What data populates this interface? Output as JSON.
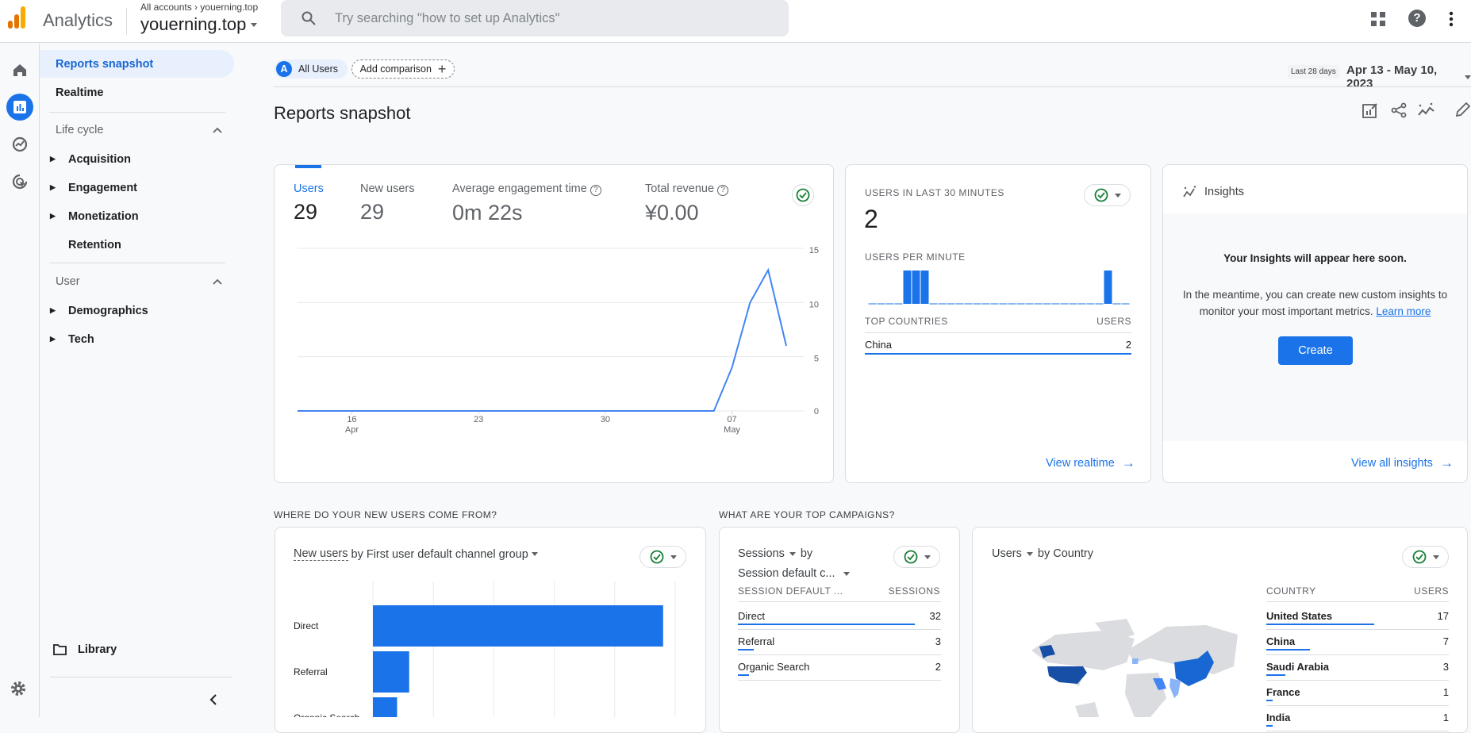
{
  "app": {
    "name": "Analytics",
    "breadcrumb": "All accounts",
    "breadcrumb_sep": "›",
    "account": "youerning.top",
    "property": "youerning.top",
    "search_placeholder": "Try searching \"how to set up Analytics\""
  },
  "sidebar": {
    "active": "Reports snapshot",
    "realtime": "Realtime",
    "sections": [
      {
        "title": "Life cycle",
        "items": [
          "Acquisition",
          "Engagement",
          "Monetization",
          "Retention"
        ]
      },
      {
        "title": "User",
        "items": [
          "Demographics",
          "Tech"
        ]
      }
    ],
    "library": "Library"
  },
  "toolbar": {
    "segment_letter": "A",
    "segment": "All Users",
    "add_comparison": "Add comparison",
    "date_chip": "Last 28 days",
    "date_range": "Apr 13 - May 10, 2023"
  },
  "page": {
    "title": "Reports snapshot"
  },
  "colors": {
    "accent": "#1a73e8",
    "us": "#174ea6",
    "china": "#1967d2",
    "saudi": "#4285f4",
    "light": "#8ab4f8"
  },
  "overview": {
    "metrics": [
      {
        "label": "Users",
        "value": "29"
      },
      {
        "label": "New users",
        "value": "29"
      },
      {
        "label": "Average engagement time",
        "value": "0m 22s"
      },
      {
        "label": "Total revenue",
        "value": "¥0.00"
      }
    ]
  },
  "chart_data": [
    {
      "type": "line",
      "title": "",
      "x_start": "2023-04-13",
      "x": [
        "Apr 13",
        "Apr 14",
        "Apr 15",
        "Apr 16",
        "Apr 17",
        "Apr 18",
        "Apr 19",
        "Apr 20",
        "Apr 21",
        "Apr 22",
        "Apr 23",
        "Apr 24",
        "Apr 25",
        "Apr 26",
        "Apr 27",
        "Apr 28",
        "Apr 29",
        "Apr 30",
        "May 1",
        "May 2",
        "May 3",
        "May 4",
        "May 5",
        "May 6",
        "May 7",
        "May 8",
        "May 9",
        "May 10"
      ],
      "series": [
        {
          "values": [
            0,
            0,
            0,
            0,
            0,
            0,
            0,
            0,
            0,
            0,
            0,
            0,
            0,
            0,
            0,
            0,
            0,
            0,
            0,
            0,
            0,
            0,
            0,
            0,
            4,
            10,
            13,
            6
          ]
        }
      ],
      "ylim": [
        0,
        15
      ],
      "yticks": [
        "15",
        "10",
        "5",
        "0"
      ],
      "xticks": [
        {
          "day": "16",
          "month": "Apr"
        },
        {
          "day": "23",
          "month": ""
        },
        {
          "day": "30",
          "month": ""
        },
        {
          "day": "07",
          "month": "May"
        }
      ],
      "grid": true
    },
    {
      "type": "bar",
      "title": "Users per minute",
      "values": [
        0,
        0,
        0,
        0,
        1,
        1,
        1,
        0,
        0,
        0,
        0,
        0,
        0,
        0,
        0,
        0,
        0,
        0,
        0,
        0,
        0,
        0,
        0,
        0,
        0,
        0,
        0,
        1,
        0,
        0
      ]
    },
    {
      "type": "bar",
      "orientation": "horizontal",
      "categories": [
        "Direct",
        "Referral",
        "Organic Search"
      ],
      "values": [
        24,
        3,
        2
      ],
      "xlim": [
        0,
        25
      ]
    }
  ],
  "realtime": {
    "title": "Users in last 30 minutes",
    "value": "2",
    "per_minute": "Users per minute",
    "col1": "Top countries",
    "col2": "Users",
    "rows": [
      {
        "country": "China",
        "users": "2"
      }
    ],
    "link": "View realtime"
  },
  "insights": {
    "title": "Insights",
    "heading": "Your Insights will appear here soon.",
    "body": "In the meantime, you can create new custom insights to monitor your most important metrics.",
    "learn": "Learn more",
    "create": "Create",
    "link": "View all insights"
  },
  "sections": {
    "new_users": "Where do your new users come from?",
    "campaigns": "What are your top campaigns?"
  },
  "new_users_card": {
    "metric": "New users",
    "by": "by First user default channel group"
  },
  "campaigns": {
    "metric": "Sessions",
    "by": "by",
    "dim": "Session default c...",
    "col1": "Session default ...",
    "col2": "Sessions",
    "rows": [
      {
        "name": "Direct",
        "value": "32",
        "frac": 0.87
      },
      {
        "name": "Referral",
        "value": "3",
        "frac": 0.08
      },
      {
        "name": "Organic Search",
        "value": "2",
        "frac": 0.055
      }
    ]
  },
  "country": {
    "metric": "Users",
    "by": "by Country",
    "col1": "Country",
    "col2": "Users",
    "rows": [
      {
        "name": "United States",
        "value": "17",
        "frac": 0.59
      },
      {
        "name": "China",
        "value": "7",
        "frac": 0.24
      },
      {
        "name": "Saudi Arabia",
        "value": "3",
        "frac": 0.105
      },
      {
        "name": "France",
        "value": "1",
        "frac": 0.035
      },
      {
        "name": "India",
        "value": "1",
        "frac": 0.035
      }
    ]
  }
}
